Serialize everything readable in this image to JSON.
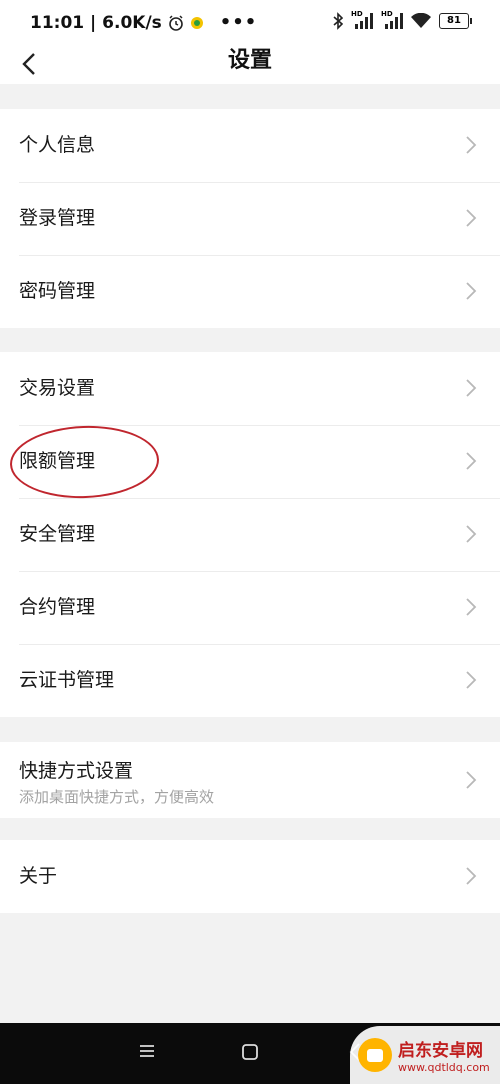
{
  "status_bar": {
    "time_speed": "11:01 | 6.0K/s",
    "signal1": "HD",
    "signal2": "HD",
    "battery": "81"
  },
  "header": {
    "title": "设置"
  },
  "groups": [
    {
      "items": [
        {
          "label": "个人信息"
        },
        {
          "label": "登录管理"
        },
        {
          "label": "密码管理"
        }
      ]
    },
    {
      "items": [
        {
          "label": "交易设置"
        },
        {
          "label": "限额管理"
        },
        {
          "label": "安全管理"
        },
        {
          "label": "合约管理"
        },
        {
          "label": "云证书管理"
        }
      ]
    },
    {
      "items": [
        {
          "label": "快捷方式设置",
          "sub": "添加桌面快捷方式，方便高效"
        }
      ]
    },
    {
      "items": [
        {
          "label": "关于"
        }
      ]
    }
  ],
  "annotation": {
    "color": "#c0262e"
  },
  "watermark": {
    "name": "启东安卓网",
    "url": "www.qdtldq.com"
  }
}
